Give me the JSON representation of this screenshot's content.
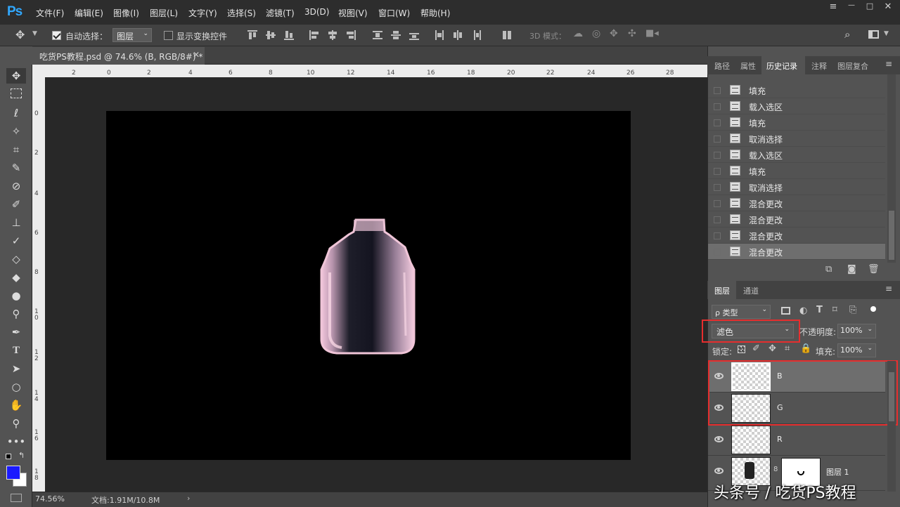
{
  "app": {
    "logo": "Ps"
  },
  "menu": [
    "文件(F)",
    "编辑(E)",
    "图像(I)",
    "图层(L)",
    "文字(Y)",
    "选择(S)",
    "滤镜(T)",
    "3D(D)",
    "视图(V)",
    "窗口(W)",
    "帮助(H)"
  ],
  "window_controls": [
    "≡",
    "—",
    "□",
    "✕"
  ],
  "options": {
    "auto_select_label": "自动选择：",
    "auto_select_value": "图层",
    "show_transform_label": "显示变换控件",
    "mode_3d_label": "3D 模式："
  },
  "document": {
    "tab_title": "吃货PS教程.psd @ 74.6% (B, RGB/8#) *",
    "zoom": "74.56%",
    "doc_info": "文档:1.91M/10.8M",
    "ruler_h": [
      "2",
      "0",
      "2",
      "4",
      "6",
      "8",
      "10",
      "12",
      "14",
      "16",
      "18",
      "20",
      "22",
      "24",
      "26",
      "28"
    ],
    "ruler_v": [
      "0",
      "2",
      "4",
      "6",
      "8",
      "1 0",
      "1 2",
      "1 4",
      "1 6",
      "1 8"
    ]
  },
  "history_panel": {
    "tabs": [
      "路径",
      "属性",
      "历史记录",
      "注释",
      "图层复合"
    ],
    "active_tab": "历史记录",
    "items": [
      "填充",
      "载入选区",
      "填充",
      "取消选择",
      "载入选区",
      "填充",
      "取消选择",
      "混合更改",
      "混合更改",
      "混合更改",
      "混合更改"
    ],
    "selected_index": 10
  },
  "layers_panel": {
    "tabs": [
      "图层",
      "通道"
    ],
    "filter_kind": "ρ 类型",
    "blend_mode": "滤色",
    "opacity_label": "不透明度:",
    "opacity": "100%",
    "lock_label": "锁定:",
    "fill_label": "填充:",
    "fill": "100%",
    "layers": [
      {
        "name": "B",
        "visible": true,
        "active": true
      },
      {
        "name": "G",
        "visible": true,
        "active": false
      },
      {
        "name": "R",
        "visible": true,
        "active": false
      },
      {
        "name": "图层 1",
        "visible": true,
        "active": false,
        "has_mask": true
      }
    ]
  },
  "colors": {
    "foreground": "#1a1aff",
    "background": "#ffffff",
    "highlight_box": "#e62e2e"
  },
  "watermark": "头条号 / 吃货PS教程"
}
